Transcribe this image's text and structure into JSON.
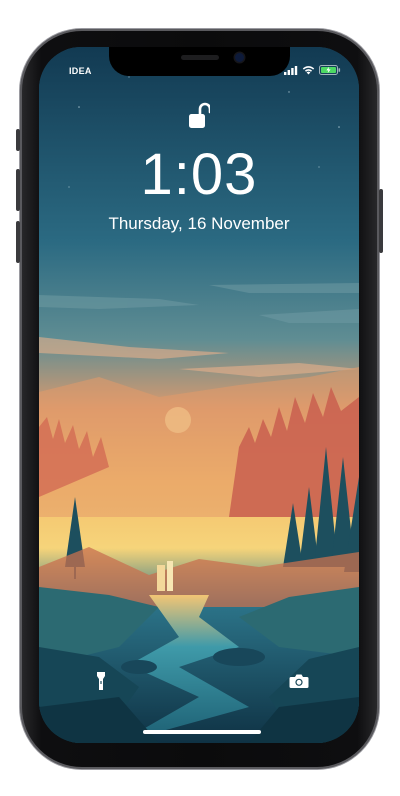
{
  "status_bar": {
    "carrier": "IDEA",
    "signal_icon": "cellular-signal-icon",
    "wifi_icon": "wifi-icon",
    "battery_icon": "battery-charging-icon",
    "battery_color": "#4cd964"
  },
  "lock_screen": {
    "lock_icon": "unlocked-padlock-icon",
    "time": "1:03",
    "date": "Thursday, 16 November"
  },
  "quick_actions": {
    "left_icon": "flashlight-icon",
    "right_icon": "camera-icon"
  },
  "home_indicator": "home-indicator-bar",
  "colors": {
    "sky_top": "#143f57",
    "sky_mid": "#2f6f86",
    "horizon": "#f3b86a",
    "sunset": "#e8874f",
    "water": "#2e7f93"
  }
}
